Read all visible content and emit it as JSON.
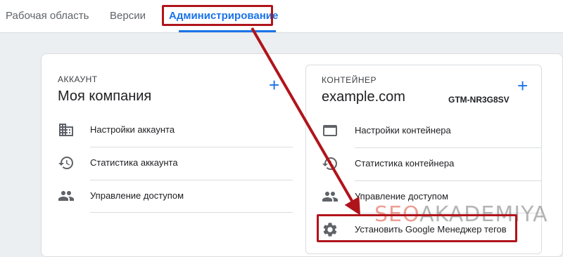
{
  "tabs": [
    {
      "label": "Рабочая область"
    },
    {
      "label": "Версии"
    },
    {
      "label": "Администрирование"
    }
  ],
  "account": {
    "section_label": "АККАУНТ",
    "name": "Моя компания",
    "items": [
      {
        "label": "Настройки аккаунта",
        "icon": "building-icon"
      },
      {
        "label": "Статистика аккаунта",
        "icon": "history-icon"
      },
      {
        "label": "Управление доступом",
        "icon": "people-icon"
      }
    ]
  },
  "container": {
    "section_label": "КОНТЕЙНЕР",
    "name": "example.com",
    "id": "GTM-NR3G8SV",
    "items": [
      {
        "label": "Настройки контейнера",
        "icon": "browser-window-icon"
      },
      {
        "label": "Статистика контейнера",
        "icon": "history-icon"
      },
      {
        "label": "Управление доступом",
        "icon": "people-icon"
      },
      {
        "label": "Установить Google Менеджер тегов",
        "icon": "gear-icon"
      }
    ]
  },
  "watermark": {
    "part1": "SEO",
    "part2": "AKADEMIYA"
  },
  "colors": {
    "accent": "#1a73e8",
    "highlight": "#b0141b",
    "text": "#202124",
    "icon": "#5f6368"
  }
}
